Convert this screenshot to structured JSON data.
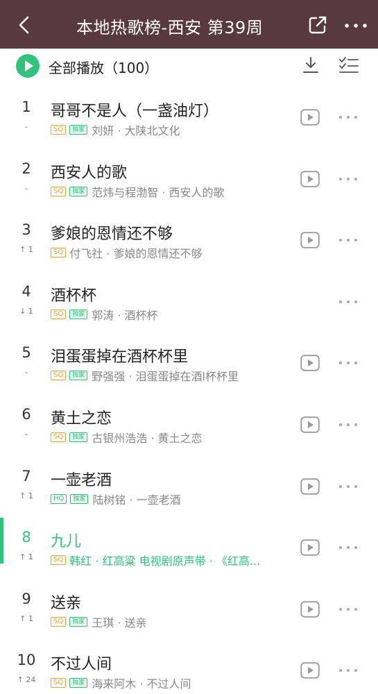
{
  "header": {
    "title": "本地热歌榜-西安 第39周"
  },
  "toolbar": {
    "play_all_label": "全部播放（100）"
  },
  "colors": {
    "header_bg": "#58393f",
    "accent": "#31c27c",
    "sq_badge": "#e0a63a"
  },
  "songs": [
    {
      "rank": "1",
      "trend": "–",
      "title": "哥哥不是人（一盏油灯）",
      "quality": "SQ",
      "exclusive": "独家",
      "artist_album": "刘妍 · 大陕北文化",
      "has_play": true,
      "active": false
    },
    {
      "rank": "2",
      "trend": "–",
      "title": "西安人的歌",
      "quality": "SQ",
      "exclusive": "独家",
      "artist_album": "范炜与程渤智 · 西安人的歌",
      "has_play": true,
      "active": false
    },
    {
      "rank": "3",
      "trend": "↑ 1",
      "title": "爹娘的恩情还不够",
      "quality": "SQ",
      "exclusive": "",
      "artist_album": "付飞社 · 爹娘的恩情还不够",
      "has_play": true,
      "active": false
    },
    {
      "rank": "4",
      "trend": "↓ 1",
      "title": "酒杯杯",
      "quality": "SQ",
      "exclusive": "独家",
      "artist_album": "郭涛 · 酒杯杯",
      "has_play": false,
      "active": false
    },
    {
      "rank": "5",
      "trend": "–",
      "title": "泪蛋蛋掉在酒杯杯里",
      "quality": "SQ",
      "exclusive": "独家",
      "artist_album": "野强强 · 泪蛋蛋掉在酒l杯杯里",
      "has_play": true,
      "active": false
    },
    {
      "rank": "6",
      "trend": "–",
      "title": "黄土之恋",
      "quality": "SQ",
      "exclusive": "独家",
      "artist_album": "古银州浩浩 · 黄土之恋",
      "has_play": true,
      "active": false
    },
    {
      "rank": "7",
      "trend": "↑ 1",
      "title": "一壶老酒",
      "quality": "HQ",
      "exclusive": "独家",
      "artist_album": "陆树铭 · 一壶老酒",
      "has_play": true,
      "active": false
    },
    {
      "rank": "8",
      "trend": "↑ 1",
      "title": "九儿",
      "quality": "SQ",
      "exclusive": "",
      "artist_album": "韩红 · 红高粱 电视剧原声带 · 《红高...",
      "has_play": true,
      "active": true
    },
    {
      "rank": "9",
      "trend": "↑ 1",
      "title": "送亲",
      "quality": "SQ",
      "exclusive": "独家",
      "artist_album": "王琪 · 送亲",
      "has_play": true,
      "active": false
    },
    {
      "rank": "10",
      "trend": "↑ 24",
      "title": "不过人间",
      "quality": "SQ",
      "exclusive": "独家",
      "artist_album": "海来阿木 · 不过人间",
      "has_play": true,
      "active": false
    }
  ]
}
